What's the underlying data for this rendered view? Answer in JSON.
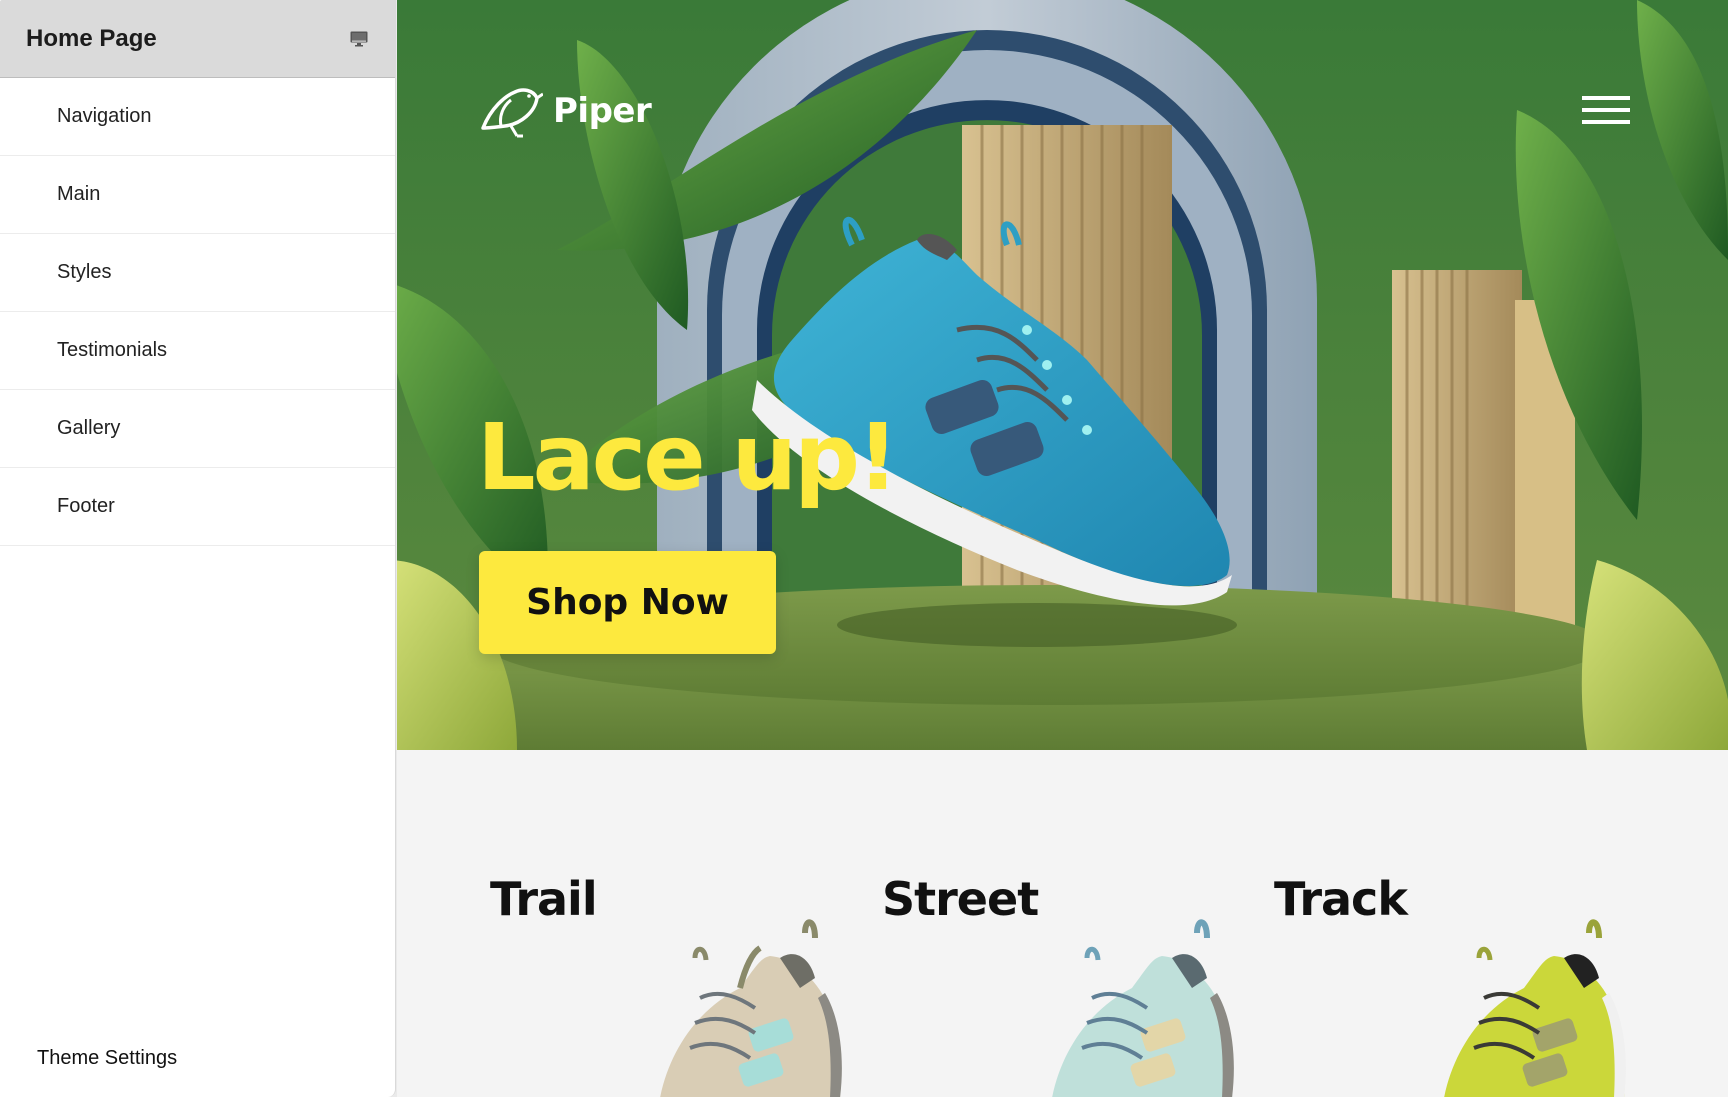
{
  "sidebar": {
    "title": "Home Page",
    "device_icon": "monitor-icon",
    "items": [
      {
        "label": "Navigation"
      },
      {
        "label": "Main"
      },
      {
        "label": "Styles"
      },
      {
        "label": "Testimonials"
      },
      {
        "label": "Gallery"
      },
      {
        "label": "Footer"
      }
    ],
    "theme_settings_label": "Theme Settings"
  },
  "preview": {
    "brand": {
      "name": "Piper",
      "logo_icon": "bird-icon"
    },
    "menu_icon": "hamburger-menu-icon",
    "hero": {
      "headline": "Lace up!",
      "cta_label": "Shop Now"
    },
    "categories": [
      {
        "title": "Trail",
        "shoe_color": "#d9cdb5",
        "accent": "#a7ddd8"
      },
      {
        "title": "Street",
        "shoe_color": "#bfe0da",
        "accent": "#e3d6a8"
      },
      {
        "title": "Track",
        "shoe_color": "#cbd73a",
        "accent": "#a3a46a"
      }
    ]
  },
  "colors": {
    "accent_yellow": "#fde93e",
    "hero_green": "#4d7f3c",
    "shoe_blue": "#2fa3c9",
    "sidebar_header_bg": "#dadada"
  }
}
